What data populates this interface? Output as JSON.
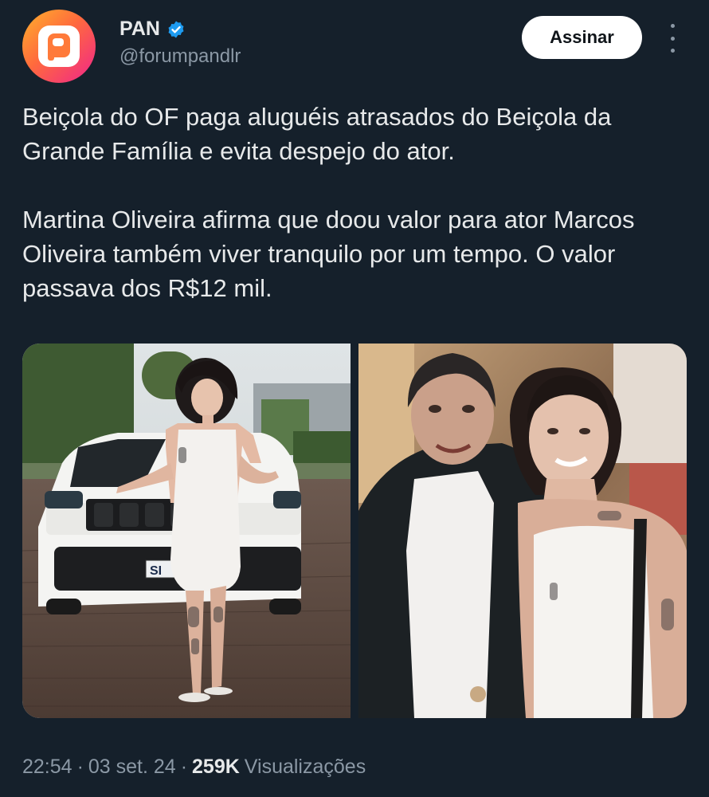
{
  "author": {
    "name": "PAN",
    "handle": "@forumpandlr",
    "verified": true,
    "avatar_colors": [
      "#ffb22b",
      "#ff6a3d",
      "#f0248c"
    ]
  },
  "subscribe_label": "Assinar",
  "more_icon": "more-vertical-icon",
  "tweet": {
    "paragraphs": [
      "Beiçola do OF paga aluguéis atrasados do Beiçola da Grande Família e evita despejo do ator.",
      "Martina Oliveira afirma que doou valor para ator Marcos Oliveira também viver tranquilo por um tempo. O valor passava dos R$12 mil."
    ]
  },
  "media": {
    "left_photo": "photo-woman-with-white-suv",
    "right_photo": "photo-man-and-woman-smiling",
    "plate_text": "SI"
  },
  "footer": {
    "time": "22:54",
    "date": "03 set. 24",
    "separator": "·",
    "views_count": "259K",
    "views_label": "Visualizações"
  },
  "colors": {
    "background": "#15202b",
    "text_primary": "#e7e9ea",
    "text_secondary": "#8b98a5",
    "verified_blue": "#1d9bf0"
  }
}
